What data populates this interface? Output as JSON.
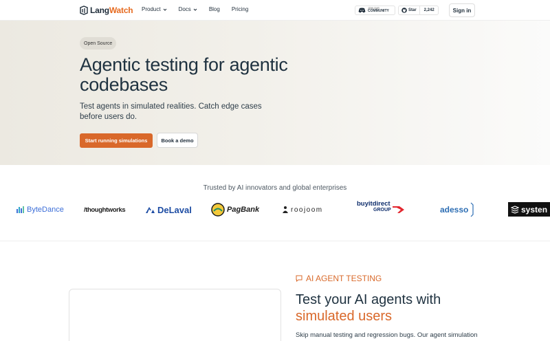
{
  "nav": {
    "logo_a": "Lang",
    "logo_b": "Watch",
    "links": [
      "Product",
      "Docs",
      "Blog",
      "Pricing"
    ],
    "discord_small": "JOIN OUR",
    "discord_big": "COMMUNITY",
    "github_label": "Star",
    "github_count": "2,242",
    "signin": "Sign in"
  },
  "hero": {
    "badge": "Open Source",
    "title": "Agentic testing for agentic codebases",
    "subtitle": "Test agents in simulated realities. Catch edge cases before users do.",
    "cta_primary": "Start running simulations",
    "cta_secondary": "Book a demo"
  },
  "trusted": {
    "heading": "Trusted by AI innovators and global enterprises",
    "logos": {
      "bytedance": "ByteDance",
      "thoughtworks": "/thoughtworks",
      "delaval": "DeLaval",
      "pagbank": "PagBank",
      "roojoom": "roojoom",
      "buyit_1": "buyitdirect",
      "buyit_2": "GROUP",
      "adesso": "adesso",
      "system": "systen"
    }
  },
  "section": {
    "eyebrow": "AI AGENT TESTING",
    "title_a": "Test your AI agents with",
    "title_b": "simulated users",
    "body": "Skip manual testing and regression bugs. Our agent simulation"
  },
  "colors": {
    "accent": "#d9682a",
    "ink": "#1f3240"
  }
}
